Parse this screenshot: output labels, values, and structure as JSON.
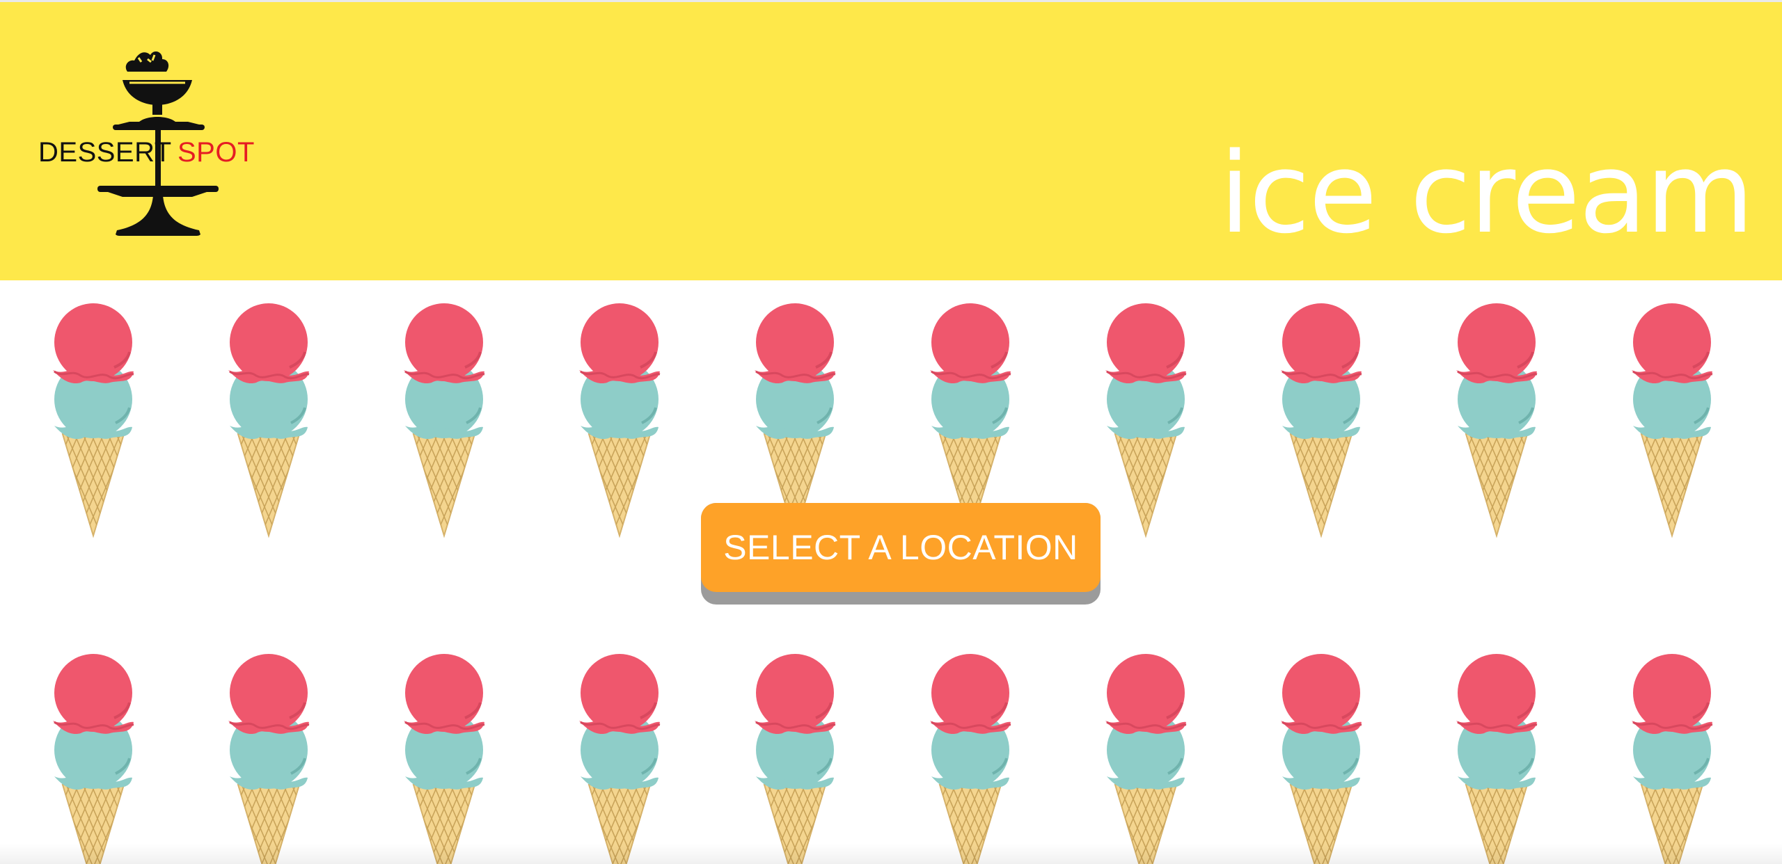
{
  "header": {
    "logo": {
      "word_left": "DESSERT",
      "word_right": "SPOT"
    },
    "title": "ice cream",
    "background_color": "#fee84a"
  },
  "gallery": {
    "rows": 2,
    "cones_per_row": 10,
    "icon": "ice-cream-cone-icon",
    "colors": {
      "top_scoop": "#ef576d",
      "bottom_scoop": "#8ecdc8",
      "cone": "#f4d58f"
    }
  },
  "cta": {
    "label": "SELECT A LOCATION",
    "color": "#fea228"
  }
}
